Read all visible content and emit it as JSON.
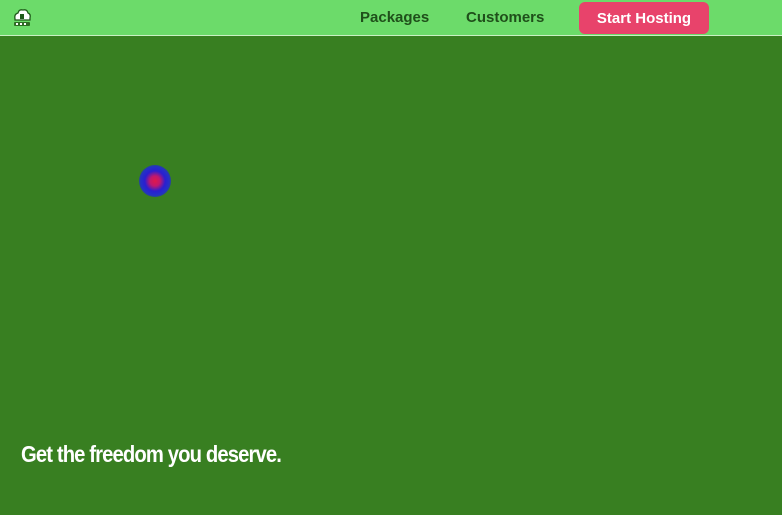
{
  "header": {
    "nav": {
      "packages_label": "Packages",
      "customers_label": "Customers"
    },
    "cta_label": "Start Hosting",
    "logo_icon": "cloud-house-logo-icon"
  },
  "hero": {
    "tagline": "Get the freedom you deserve."
  },
  "colors": {
    "header_bg": "#6cdb6a",
    "page_bg": "#387f21",
    "cta_bg": "#e8436b",
    "nav_text": "#1f4f1a"
  }
}
